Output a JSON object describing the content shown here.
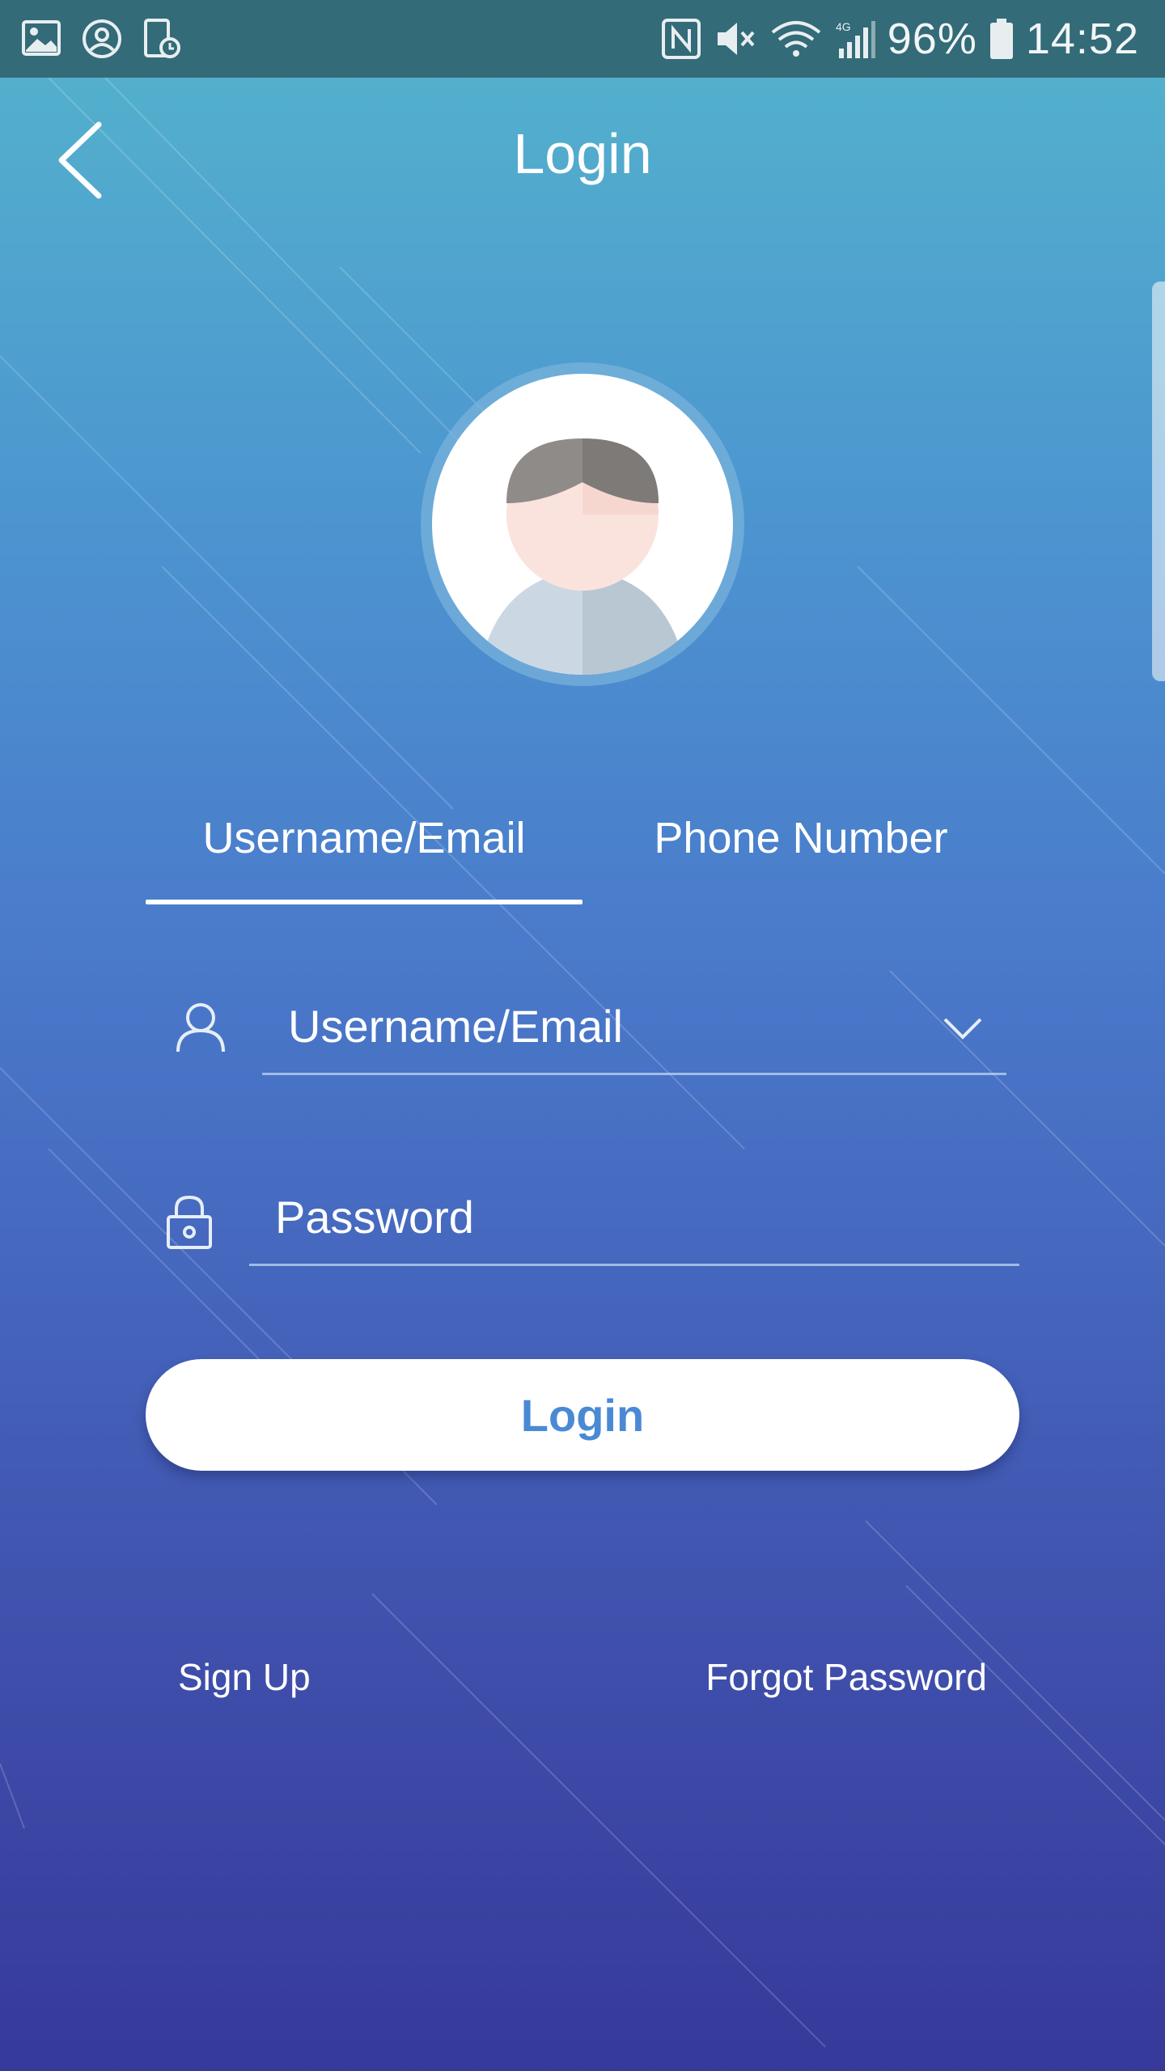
{
  "status_bar": {
    "icons_left": [
      "image-icon",
      "account-circle-icon",
      "clock-doc-icon"
    ],
    "icons_right": [
      "nfc-icon",
      "vibrate-mute-icon",
      "wifi-icon",
      "signal-4g-icon",
      "battery-icon"
    ],
    "battery": "96%",
    "time": "14:52"
  },
  "header": {
    "title": "Login",
    "back_icon": "chevron-left-icon"
  },
  "avatar": {
    "icon": "default-user-avatar"
  },
  "tabs": [
    {
      "label": "Username/Email",
      "active": true
    },
    {
      "label": "Phone Number",
      "active": false
    }
  ],
  "form": {
    "username": {
      "placeholder": "Username/Email",
      "value": "",
      "icon": "user-icon",
      "dropdown_icon": "chevron-down-icon"
    },
    "password": {
      "placeholder": "Password",
      "value": "",
      "icon": "lock-icon"
    },
    "login_label": "Login"
  },
  "links": {
    "sign_up": "Sign Up",
    "forgot_password": "Forgot Password"
  },
  "colors": {
    "status_bar": "#336b78",
    "gradient_top": "#54b4cc",
    "gradient_bottom": "#36399a",
    "login_text": "#4a8ad4"
  }
}
